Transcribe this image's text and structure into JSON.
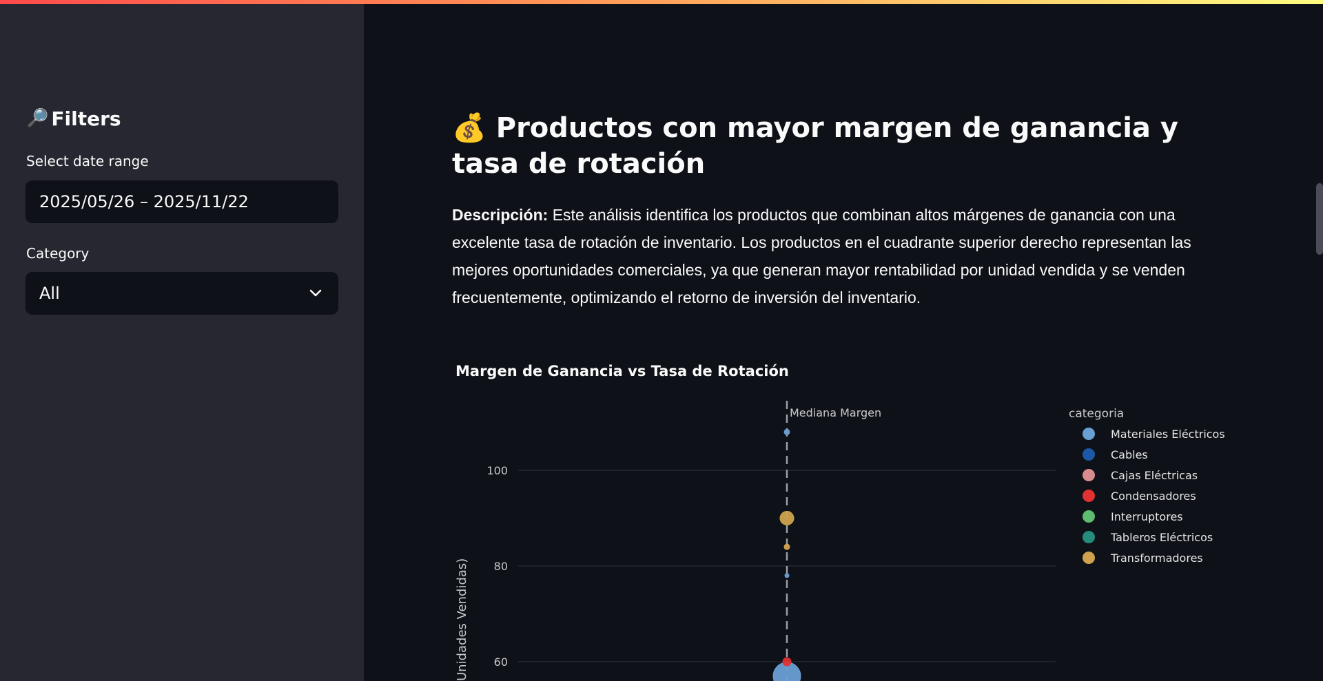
{
  "sidebar": {
    "title_icon": "magnifier-icon",
    "title": "Filters",
    "date_label": "Select date range",
    "date_value": "2025/05/26 – 2025/11/22",
    "category_label": "Category",
    "category_value": "All"
  },
  "main": {
    "title_icon": "money-bag-icon",
    "title": "Productos con mayor margen de ganancia y tasa de rotación",
    "description_label": "Descripción:",
    "description": "Este análisis identifica los productos que combinan altos márgenes de ganancia con una excelente tasa de rotación de inventario. Los productos en el cuadrante superior derecho representan las mejores oportunidades comerciales, ya que generan mayor rentabilidad por unidad vendida y se venden frecuentemente, optimizando el retorno de inversión del inventario."
  },
  "colors": {
    "sidebar_bg": "#262730",
    "main_bg": "#0e1117",
    "accent_gradient": [
      "#ff4b4b",
      "#fffd80"
    ]
  },
  "chart_data": {
    "type": "scatter",
    "title": "Margen de Ganancia vs Tasa de Rotación",
    "ylabel": "Unidades Vendidas)",
    "yticks": [
      60,
      80,
      100
    ],
    "ylim": [
      56,
      114
    ],
    "grid": true,
    "median_line_label": "Mediana Margen",
    "legend_title": "categoria",
    "legend_position": "top-right",
    "series": [
      {
        "name": "Materiales Eléctricos",
        "color": "#6a9fd4",
        "points": [
          {
            "y": 108,
            "size": 4
          },
          {
            "y": 78,
            "size": 3
          },
          {
            "y": 57,
            "size": 20
          }
        ]
      },
      {
        "name": "Cables",
        "color": "#1c58a8",
        "points": []
      },
      {
        "name": "Cajas Eléctricas",
        "color": "#d88b8f",
        "points": []
      },
      {
        "name": "Condensadores",
        "color": "#e03232",
        "points": [
          {
            "y": 60,
            "size": 6
          }
        ]
      },
      {
        "name": "Interruptores",
        "color": "#5dbc71",
        "points": []
      },
      {
        "name": "Tableros Eléctricos",
        "color": "#258b7b",
        "points": []
      },
      {
        "name": "Transformadores",
        "color": "#cfa24e",
        "points": [
          {
            "y": 90,
            "size": 10
          },
          {
            "y": 84,
            "size": 4
          }
        ]
      }
    ]
  }
}
